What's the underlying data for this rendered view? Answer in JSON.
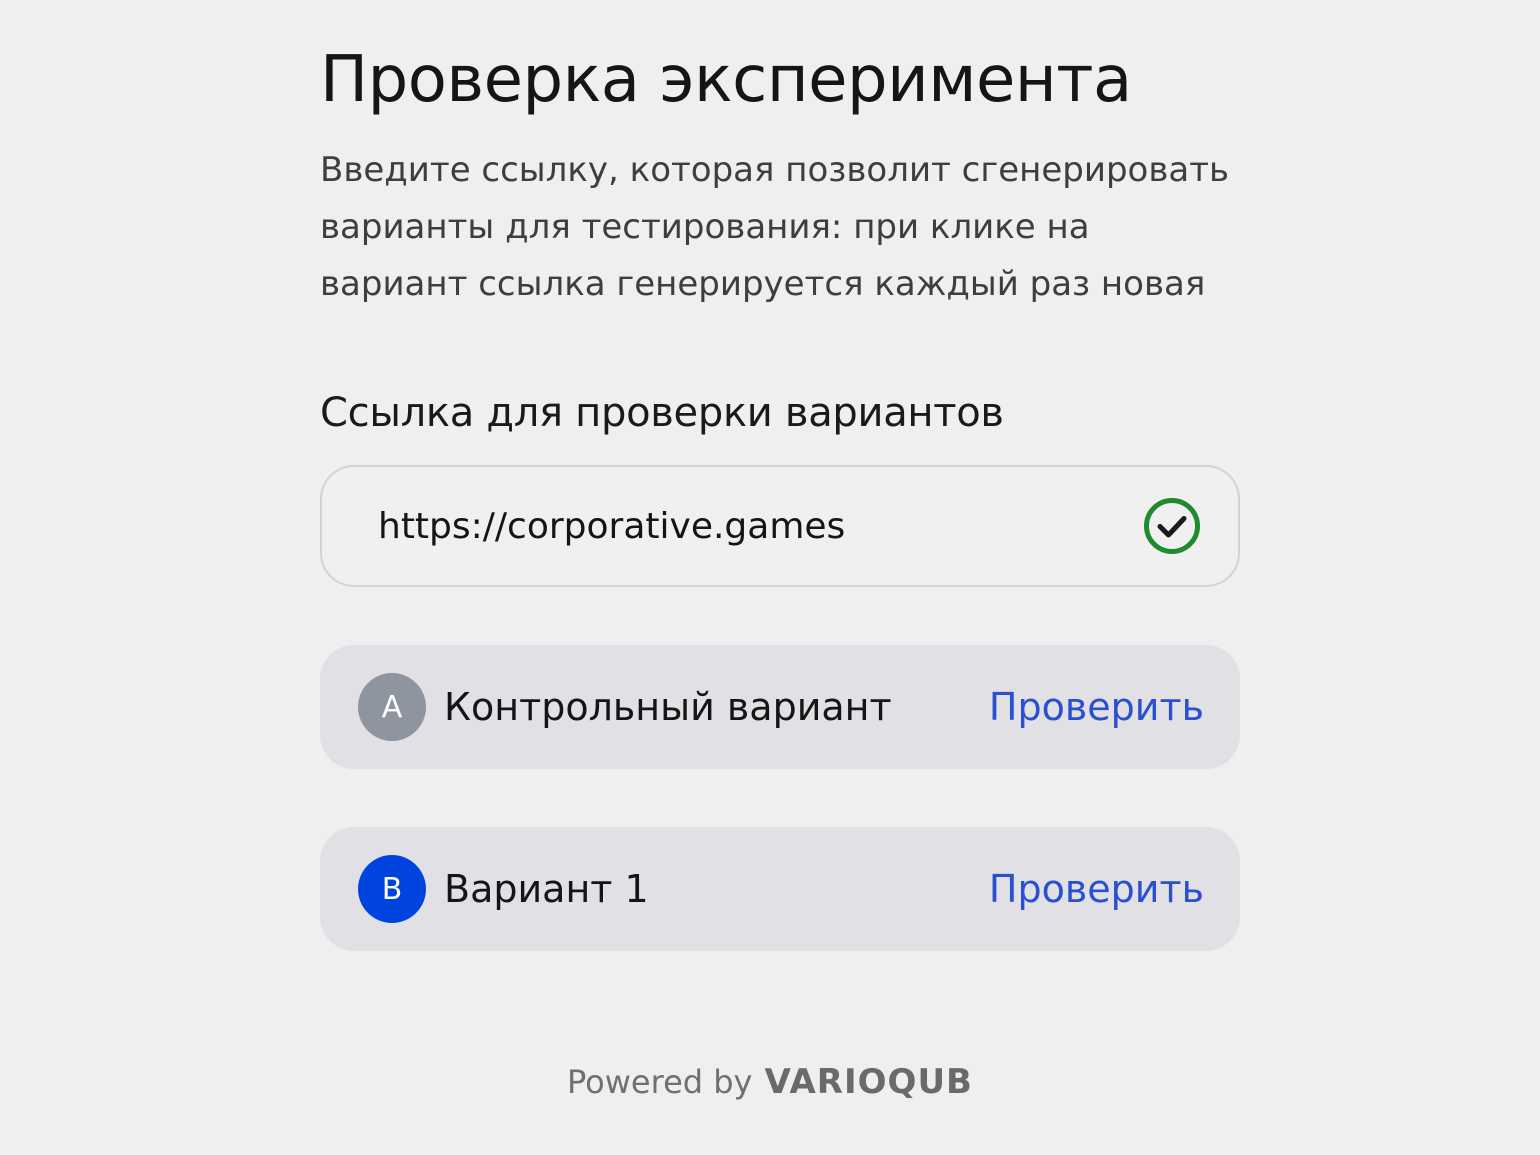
{
  "header": {
    "title": "Проверка эксперимента",
    "description": "Введите ссылку, которая позволит сгенерировать варианты для тестирования: при клике на вариант ссылка генерируется каждый раз новая"
  },
  "url_section": {
    "label": "Ссылка для проверки вариантов",
    "value": "https://corporative.games",
    "status_icon": "check-circle-icon",
    "status_color": "#1f8a2e"
  },
  "variants": [
    {
      "badge": "A",
      "name": "Контрольный вариант",
      "action_label": "Проверить",
      "badge_color": "#8e94a0"
    },
    {
      "badge": "B",
      "name": "Вариант 1",
      "action_label": "Проверить",
      "badge_color": "#0044e0"
    }
  ],
  "footer": {
    "powered_by": "Powered by",
    "brand": "VARIOQUB"
  }
}
